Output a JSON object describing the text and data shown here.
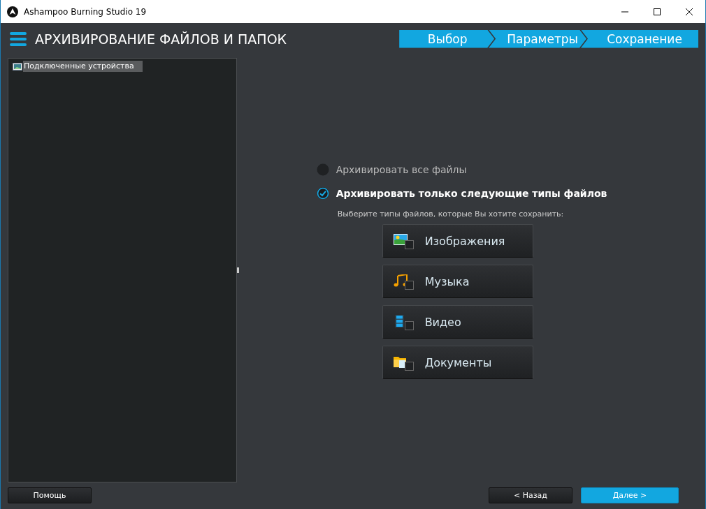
{
  "window": {
    "title": "Ashampoo Burning Studio 19"
  },
  "header": {
    "title": "АРХИВИРОВАНИЕ ФАЙЛОВ И ПАПОК"
  },
  "steps": [
    "Выбор",
    "Параметры",
    "Сохранение"
  ],
  "tree": {
    "items": [
      {
        "label": "Подключенные устройства",
        "selected": true
      }
    ]
  },
  "options": [
    {
      "label": "Архивировать все файлы",
      "selected": false
    },
    {
      "label": "Архивировать только следующие типы файлов",
      "selected": true
    }
  ],
  "hint": "Выберите типы файлов, которые Вы хотите сохранить:",
  "file_types": [
    {
      "kind": "images",
      "label": "Изображения",
      "checked": false
    },
    {
      "kind": "music",
      "label": "Музыка",
      "checked": false
    },
    {
      "kind": "video",
      "label": "Видео",
      "checked": false
    },
    {
      "kind": "documents",
      "label": "Документы",
      "checked": false
    }
  ],
  "buttons": {
    "help": "Помощь",
    "back": "< Назад",
    "next": "Далее >"
  }
}
